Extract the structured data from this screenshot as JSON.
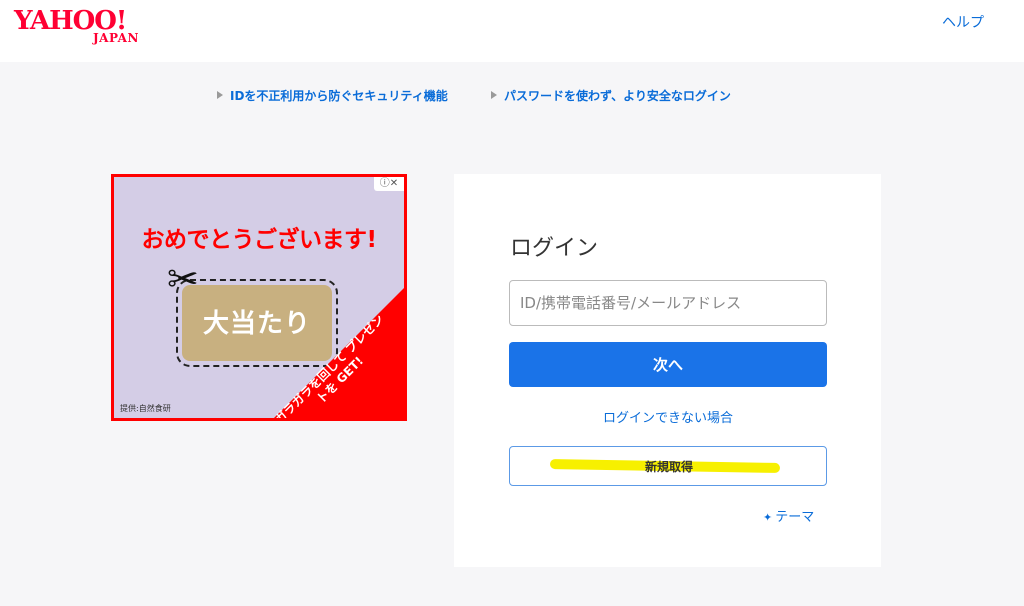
{
  "header": {
    "logo_main": "YAHOO!",
    "logo_sub": "JAPAN",
    "help_label": "ヘルプ"
  },
  "feature_links": [
    {
      "label": "IDを不正利用から防ぐセキュリティ機能"
    },
    {
      "label": "パスワードを使わず、より安全なログイン"
    }
  ],
  "ad": {
    "controls": "ⓘ✕",
    "headline": "おめでとうございます!",
    "ticket_text": "大当たり",
    "promo_text": "ガラガラを回して プレゼントを GET!",
    "provider": "提供:自然食研",
    "scissors_icon": "scissors-icon"
  },
  "login": {
    "title": "ログイン",
    "id_placeholder": "ID/携帯電話番号/メールアドレス",
    "id_value": "",
    "next_label": "次へ",
    "cannot_login_label": "ログインできない場合",
    "signup_label": "新規取得",
    "theme_label": "テーマ",
    "theme_icon": "sparkle-icon"
  },
  "colors": {
    "brand_red": "#ff0033",
    "link_blue": "#0a6cd8",
    "primary_button": "#1a73e8",
    "highlight_yellow": "#f7f000",
    "background": "#f6f6f8"
  }
}
